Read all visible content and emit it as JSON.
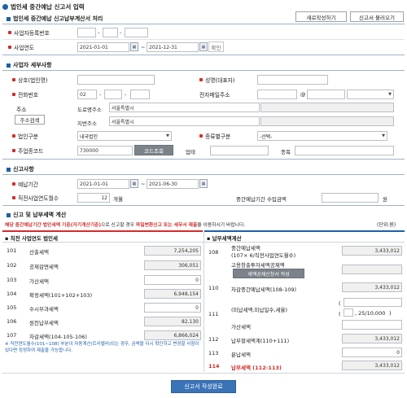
{
  "page_title": "법인세 중간예납 신고서 입력",
  "section_top": {
    "title": "법인세 중간예납 신고납부계산서 처리",
    "new_button": "새로작성하기",
    "load_button": "신고서 불러오기",
    "biz_reg_label": "사업자등록번호",
    "fiscal_year_label": "사업연도",
    "fiscal_start": "2021-01-01",
    "fiscal_end": "2021-12-31",
    "confirm_button": "확인",
    "dash": "-",
    "tilde": "~"
  },
  "company_section": {
    "title": "사업자 세부사항",
    "name_label": "상호(법인명)",
    "rep_label": "성명(대표자)",
    "phone_label": "전화번호",
    "phone_area": "02",
    "email_label": "전자메일주소",
    "email_at": "@",
    "address_label": "주소",
    "address_search_button": "주소검색",
    "road_label": "도로명주소",
    "road_value": "서울특별시",
    "lot_label": "지번주소",
    "lot_value": "서울특별시",
    "corp_type_label": "법인구분",
    "corp_type_value": "내국법인",
    "category_label": "종류별구분",
    "category_value": "-선택-",
    "industry_label": "주업종코드",
    "industry_value": "730000",
    "industry_button": "코드조회",
    "business_label": "업태",
    "item_label": "종목"
  },
  "report_section": {
    "title": "신고사항",
    "period_label": "예납기간",
    "period_start": "2021-01-01",
    "period_end": "2021-06-30",
    "months_label": "직전사업연도월수",
    "months_value": "12",
    "months_unit": "개월",
    "income_label": "중간예납기간 수입금액",
    "income_unit": "원"
  },
  "calc_section": {
    "title": "신고 및 납부세액 계산",
    "notice_prefix": "해당 중간예납기간 법인세액 기준(자기계산기준)",
    "notice_middle": "으로 신고할 경우 ",
    "notice_red": "파일변환신고 또는 세무서 제출",
    "notice_suffix": "을 이용하시기 바랍니다.",
    "unit_label": "(단위:원)",
    "left_header": "직전 사업연도 법인세",
    "right_header": "납부세액계산",
    "left_rows": [
      {
        "code": "101",
        "label": "산출세액",
        "value": "7,254,205"
      },
      {
        "code": "102",
        "label": "공제감면세액",
        "value": "306,051"
      },
      {
        "code": "103",
        "label": "가산세액",
        "value": "0"
      },
      {
        "code": "104",
        "label": "확정세액(101+102+103)",
        "value": "6,948,154"
      },
      {
        "code": "105",
        "label": "수시부과세액",
        "value": "0"
      },
      {
        "code": "106",
        "label": "원천납부세액",
        "value": "82,130"
      },
      {
        "code": "107",
        "label": "차감세액(104-105-106)",
        "value": "6,866,024"
      }
    ],
    "r108_code": "108",
    "r108_label1": "중간예납세액",
    "r108_label2": "(107× 6/직전사업연도월수)",
    "r108_value": "3,433,012",
    "r109_label": "고용창출투자세액공제액",
    "r109_button": "세액공제신청서 작성",
    "r110_code": "110",
    "r110_label": "차감중간예납세액(108-109)",
    "r110_value": "3,433,012",
    "r111_code": "111",
    "r111_label": "(미납세액,미납일수,세율)",
    "r111_paren_open": "(",
    "r111_rate": ", 25/10,000",
    "r111_paren_close": ")",
    "r111_sub_label": "가산세액",
    "r112_code": "112",
    "r112_label": "납부할세액계(110+111)",
    "r112_value": "3,433,012",
    "r113_code": "113",
    "r113_label": "분납세액",
    "r113_value": "0",
    "r114_code": "114",
    "r114_label": "납부세액 (112-113)",
    "r114_value": "3,433,012",
    "footnote": "※ 직전연도월수(101~108) 부분이 자동계산(트리밸러)되는 경우, 금액을 다시 확인하고 변경할 사항이 있다면 정정하여 제출을 가능합니다.",
    "submit_button": "신고서 작성완료"
  },
  "colors": {
    "accent": "#1d5fa8",
    "required": "#d32b2b",
    "submit": "#3a73b8"
  }
}
